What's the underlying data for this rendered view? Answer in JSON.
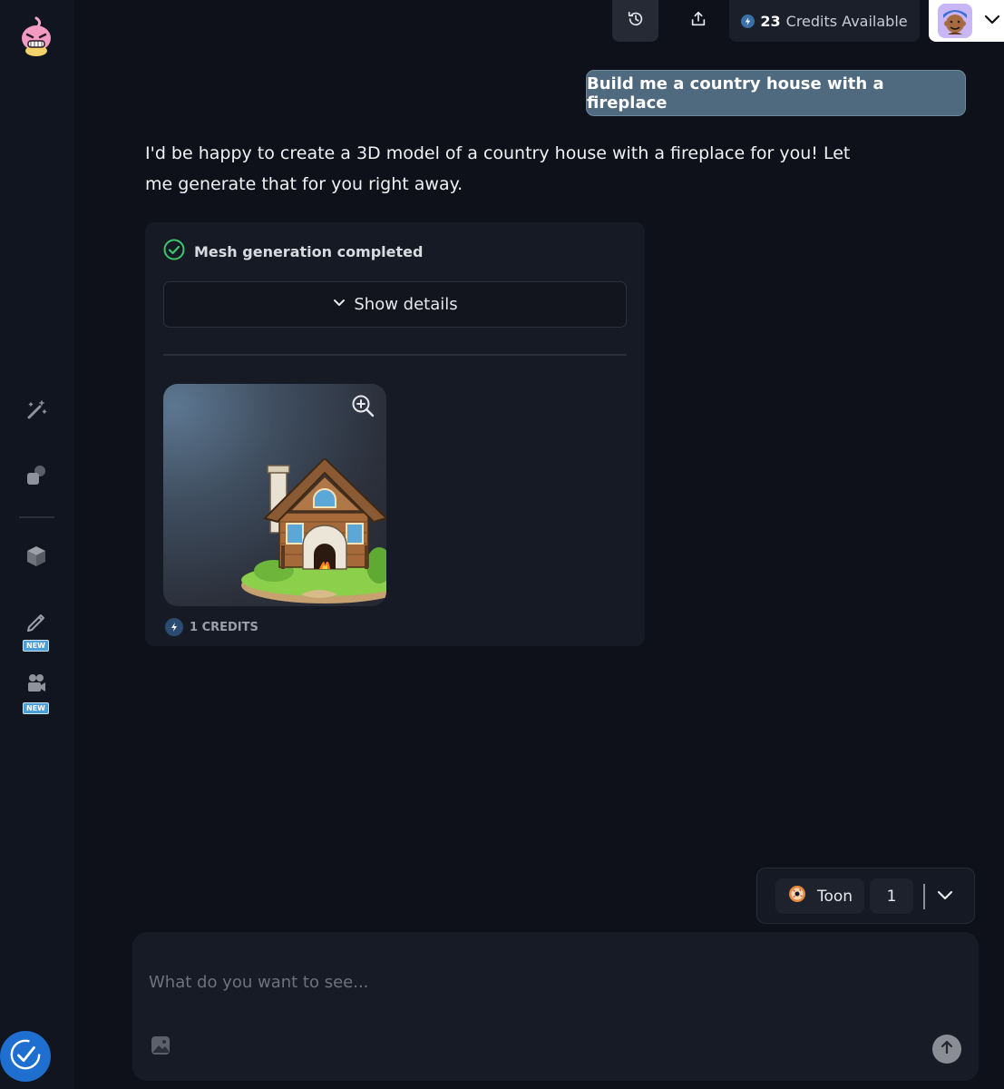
{
  "topbar": {
    "credits_count": "23",
    "credits_label": "Credits Available"
  },
  "sidebar": {
    "items": [
      {
        "icon": "magic-wand-icon"
      },
      {
        "icon": "shapes-icon"
      },
      {
        "icon": "cube-icon"
      },
      {
        "icon": "pencil-icon",
        "badge": "NEW"
      },
      {
        "icon": "video-camera-icon",
        "badge": "NEW"
      }
    ]
  },
  "chat": {
    "user_message": "Build me a country house with a fireplace",
    "assistant_message": "I'd be happy to create a 3D model of a country house with a fireplace for you! Let me generate that for you right away.",
    "generation": {
      "status": "Mesh generation completed",
      "details_label": "Show details",
      "cost": "1 CREDITS"
    }
  },
  "style_selector": {
    "style": "Toon",
    "count": "1"
  },
  "prompt": {
    "placeholder": "What do you want to see..."
  },
  "colors": {
    "background": "#0e1119",
    "user_bubble": "#4f6a7e",
    "success": "#3ec46d",
    "accent": "#1e6fd0"
  }
}
